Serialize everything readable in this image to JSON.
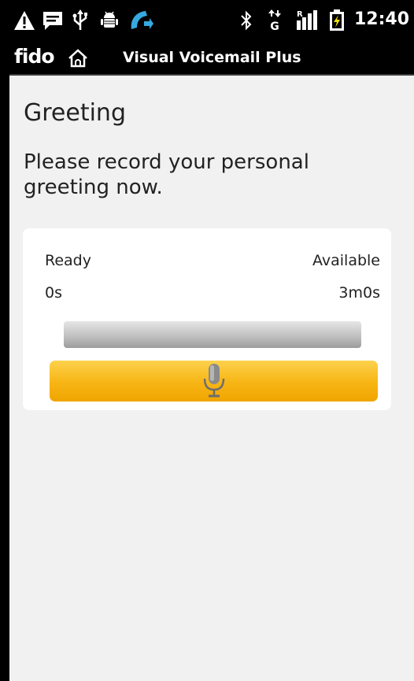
{
  "status_bar": {
    "time": "12:40",
    "icons": [
      "warning-icon",
      "message-icon",
      "usb-icon",
      "android-debug-icon",
      "call-forward-icon",
      "bluetooth-icon",
      "data-arrows-icon",
      "signal-icon",
      "battery-charging-icon"
    ],
    "data_type_label": "G",
    "roaming_label": "R"
  },
  "title_bar": {
    "brand": "fido",
    "title": "Visual Voicemail Plus"
  },
  "main": {
    "heading": "Greeting",
    "instruction": "Please record your personal greeting now.",
    "recorder": {
      "status_label": "Ready",
      "available_label": "Available",
      "elapsed": "0s",
      "available_time": "3m0s",
      "progress": 0
    },
    "record_button": {
      "icon": "microphone-icon"
    }
  },
  "colors": {
    "accent": "#f7b514",
    "call_icon": "#36a9e1",
    "battery_bolt": "#f5e300"
  }
}
